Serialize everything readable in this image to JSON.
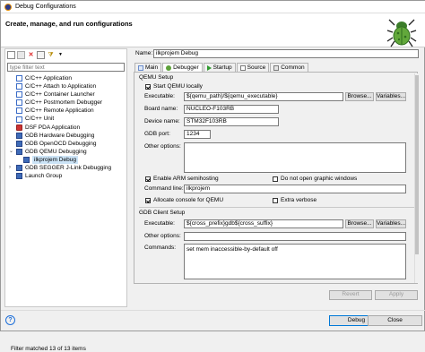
{
  "window": {
    "title": "Debug Configurations"
  },
  "banner": {
    "heading": "Create, manage, and run configurations"
  },
  "left": {
    "filter_placeholder": "type filter text",
    "tree": [
      {
        "label": "C/C++ Application",
        "icon": "c-app-icon",
        "indent": 1
      },
      {
        "label": "C/C++ Attach to Application",
        "icon": "c-app-icon",
        "indent": 1
      },
      {
        "label": "C/C++ Container Launcher",
        "icon": "c-app-icon",
        "indent": 1
      },
      {
        "label": "C/C++ Postmortem Debugger",
        "icon": "c-app-icon",
        "indent": 1
      },
      {
        "label": "C/C++ Remote Application",
        "icon": "c-app-icon",
        "indent": 1
      },
      {
        "label": "C/C++ Unit",
        "icon": "c-app-icon",
        "indent": 1
      },
      {
        "label": "DSF PDA Application",
        "icon": "pda-icon",
        "indent": 1
      },
      {
        "label": "GDB Hardware Debugging",
        "icon": "gdb-icon",
        "indent": 1
      },
      {
        "label": "GDB OpenOCD Debugging",
        "icon": "gdb-icon",
        "indent": 1
      },
      {
        "label": "GDB QEMU Debugging",
        "icon": "gdb-icon",
        "indent": 1,
        "expanded": true
      },
      {
        "label": "ilkprojem Debug",
        "icon": "gdb-icon",
        "indent": 2,
        "selected": true
      },
      {
        "label": "GDB SEGGER J-Link Debugging",
        "icon": "gdb-icon",
        "indent": 1,
        "twisty": true
      },
      {
        "label": "Launch Group",
        "icon": "launch-group-icon",
        "indent": 1
      }
    ],
    "status": "Filter matched 13 of 13 items"
  },
  "right": {
    "name_label": "Name:",
    "name_value": "ilkprojem Debug",
    "tabs": [
      {
        "label": "Main",
        "icon": "main-tab-icon"
      },
      {
        "label": "Debugger",
        "icon": "debugger-tab-icon",
        "active": true
      },
      {
        "label": "Startup",
        "icon": "startup-tab-icon"
      },
      {
        "label": "Source",
        "icon": "source-tab-icon"
      },
      {
        "label": "Common",
        "icon": "common-tab-icon"
      }
    ],
    "qemu": {
      "section": "QEMU Setup",
      "start_locally": "Start QEMU locally",
      "executable_label": "Executable:",
      "executable_value": "${qemu_path}/${qemu_executable}",
      "browse": "Browse...",
      "variables": "Variables...",
      "board_label": "Board name:",
      "board_value": "NUCLEO-F103RB",
      "device_label": "Device name:",
      "device_value": "STM32F103RB",
      "port_label": "GDB port:",
      "port_value": "1234",
      "other_label": "Other options:",
      "arm_semi": "Enable ARM semihosting",
      "no_graphic": "Do not open graphic windows",
      "cmdline_label": "Command line:",
      "cmdline_value": "ilkprojem",
      "allocate_console": "Allocate console for QEMU",
      "extra_verbose": "Extra verbose"
    },
    "gdb": {
      "section": "GDB Client Setup",
      "executable_label": "Executable:",
      "executable_value": "${cross_prefix}gdb${cross_suffix}",
      "browse": "Browse...",
      "variables": "Variables...",
      "other_label": "Other options:",
      "commands_label": "Commands:",
      "commands_value": "set mem inaccessible-by-default off"
    },
    "revert": "Revert",
    "apply": "Apply"
  },
  "footer": {
    "debug": "Debug",
    "close": "Close"
  }
}
